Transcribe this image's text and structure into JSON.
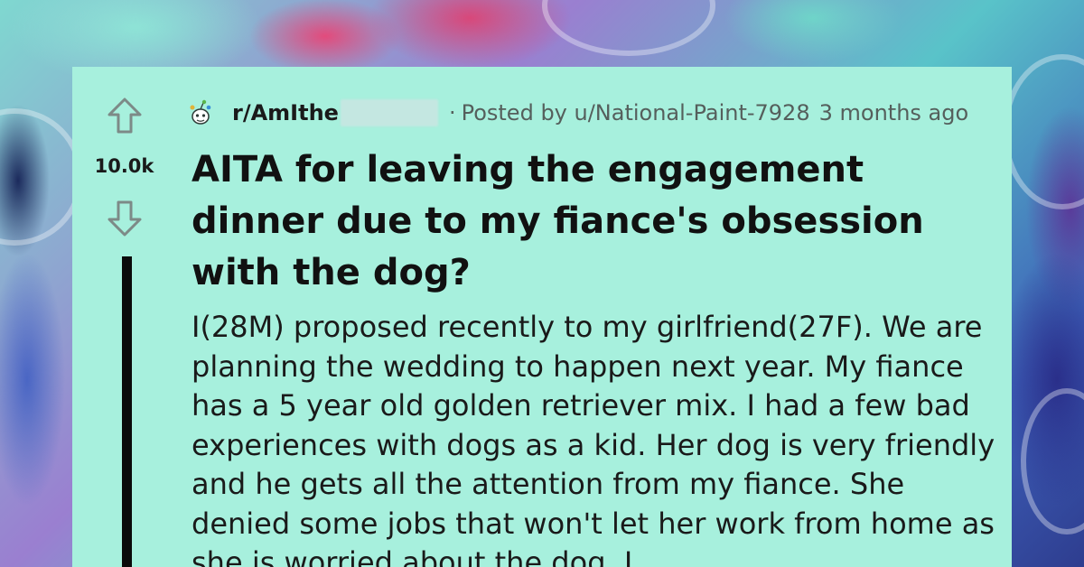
{
  "post": {
    "score": "10.0k",
    "subreddit": "r/AmIthe",
    "separator": "·",
    "posted_by": "Posted by u/National-Paint-7928",
    "time_ago": "3 months ago",
    "title": "AITA for leaving the engagement dinner due to my fiance's obsession with the dog?",
    "body": "I(28M) proposed recently to my girlfriend(27F). We are planning the wedding to happen next year. My fiance has a 5 year old golden retriever mix. I had a few bad experiences with dogs as a kid. Her dog is very friendly and he gets all the attention from my fiance. She denied some jobs that won't let her work from home as she is worried about the dog. I"
  },
  "icons": {
    "upvote": "upvote-arrow-icon",
    "downvote": "downvote-arrow-icon",
    "subreddit": "subreddit-snoo-icon"
  },
  "colors": {
    "card_background": "#a7f0dd",
    "text": "#1a1a1a",
    "meta_text": "#555f5c",
    "thread_line": "#0a0a0a"
  }
}
